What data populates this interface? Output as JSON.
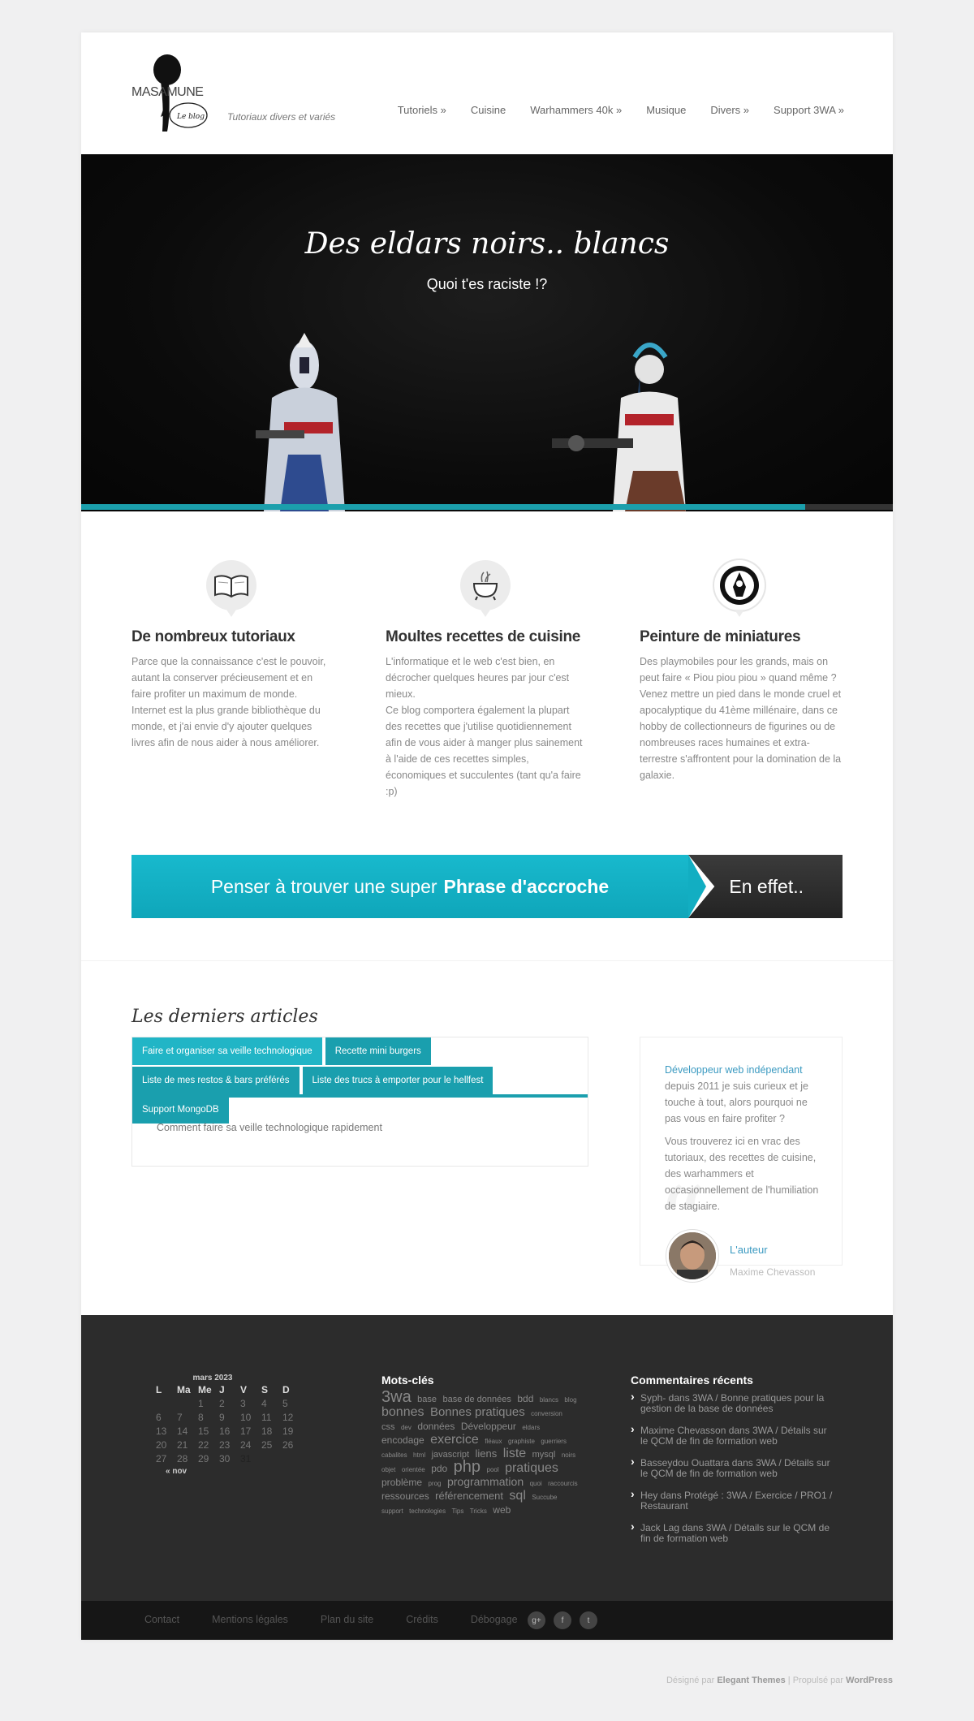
{
  "header": {
    "logo_text": "MASAMUNE",
    "logo_subtext": "Le blog",
    "tagline": "Tutoriaux divers et variés",
    "nav": [
      {
        "label": "Tutoriels »"
      },
      {
        "label": "Cuisine"
      },
      {
        "label": "Warhammers 40k »"
      },
      {
        "label": "Musique"
      },
      {
        "label": "Divers »"
      },
      {
        "label": "Support 3WA »"
      }
    ]
  },
  "hero": {
    "title": "Des eldars noirs.. blancs",
    "subtitle": "Quoi t'es raciste !?",
    "progress_fraction": 0.892
  },
  "features": [
    {
      "icon": "book-icon",
      "title": "De nombreux tutoriaux",
      "text": "Parce que la connaissance c'est le pouvoir, autant la conserver précieusement et en faire profiter un maximum de monde. Internet est la plus grande bibliothèque du monde, et j'ai envie d'y ajouter quelques livres afin de nous aider à nous améliorer."
    },
    {
      "icon": "cauldron-icon",
      "title": "Moultes recettes de cuisine",
      "text": "L'informatique et le web c'est bien, en décrocher quelques heures par jour c'est mieux.\nCe blog comportera également la plupart des recettes que j'utilise quotidiennement afin de vous aider à manger plus sainement à l'aide de ces recettes simples, économiques et succulentes (tant qu'a faire :p)"
    },
    {
      "icon": "eldar-rune-icon",
      "title": "Peinture de miniatures",
      "text": "Des playmobiles pour les grands, mais on peut faire « Piou piou piou » quand même ? Venez mettre un pied dans le monde cruel et apocalyptique du 41ème millénaire, dans ce hobby de collectionneurs de figurines ou de nombreuses races humaines et extra-terrestre s'affrontent pour la domination de la galaxie."
    }
  ],
  "cta": {
    "text_plain": "Penser à trouver une super",
    "text_bold": "Phrase d'accroche",
    "button": "En effet.."
  },
  "articles": {
    "title": "Les derniers articles",
    "tabs": [
      {
        "label": "Faire et organiser sa veille technologique"
      },
      {
        "label": "Recette mini burgers"
      },
      {
        "label": "Liste de mes restos & bars préférés"
      },
      {
        "label": "Liste des trucs à emporter pour le hellfest"
      },
      {
        "label": "Support MongoDB"
      }
    ],
    "active_content": "Comment faire sa veille technologique rapidement"
  },
  "author": {
    "lead": "Développeur web indépendant",
    "para1_rest": "depuis 2011 je suis curieux et je touche à tout, alors pourquoi ne pas vous en faire profiter ?",
    "para2": "Vous trouverez ici en vrac des tutoriaux, des recettes de cuisine, des warhammers et occasionnellement de l'humiliation de stagiaire.",
    "label": "L'auteur",
    "name": "Maxime Chevasson"
  },
  "calendar": {
    "caption": "mars 2023",
    "headers": [
      "L",
      "Ma",
      "Me",
      "J",
      "V",
      "S",
      "D"
    ],
    "rows": [
      [
        "",
        "",
        "",
        "1",
        "2",
        "3",
        "4",
        "5"
      ],
      [
        "6",
        "7",
        "8",
        "9",
        "10",
        "11",
        "12"
      ],
      [
        "13",
        "14",
        "15",
        "16",
        "17",
        "18",
        "19"
      ],
      [
        "20",
        "21",
        "22",
        "23",
        "24",
        "25",
        "26"
      ],
      [
        "27",
        "28",
        "29",
        "30",
        "31",
        "",
        ""
      ]
    ],
    "prev": "« nov"
  },
  "tags": {
    "title": "Mots-clés",
    "items": [
      {
        "t": "3wa",
        "s": 20
      },
      {
        "t": "base",
        "s": 11
      },
      {
        "t": "base de données",
        "s": 11
      },
      {
        "t": "bdd",
        "s": 12
      },
      {
        "t": "blancs",
        "s": 8
      },
      {
        "t": "blog",
        "s": 8
      },
      {
        "t": "bonnes",
        "s": 16
      },
      {
        "t": "Bonnes pratiques",
        "s": 15
      },
      {
        "t": "conversion",
        "s": 8
      },
      {
        "t": "css",
        "s": 11
      },
      {
        "t": "dev",
        "s": 8
      },
      {
        "t": "données",
        "s": 12
      },
      {
        "t": "Développeur",
        "s": 12
      },
      {
        "t": "eldars",
        "s": 8
      },
      {
        "t": "encodage",
        "s": 12
      },
      {
        "t": "exercice",
        "s": 16
      },
      {
        "t": "fléaux",
        "s": 8
      },
      {
        "t": "graphiste",
        "s": 8
      },
      {
        "t": "guerriers",
        "s": 8
      },
      {
        "t": "cabalites",
        "s": 8
      },
      {
        "t": "html",
        "s": 8
      },
      {
        "t": "javascript",
        "s": 11
      },
      {
        "t": "liens",
        "s": 13
      },
      {
        "t": "liste",
        "s": 16
      },
      {
        "t": "mysql",
        "s": 11
      },
      {
        "t": "noirs",
        "s": 8
      },
      {
        "t": "objet",
        "s": 8
      },
      {
        "t": "orientée",
        "s": 8
      },
      {
        "t": "pdo",
        "s": 12
      },
      {
        "t": "php",
        "s": 20
      },
      {
        "t": "pool",
        "s": 8
      },
      {
        "t": "pratiques",
        "s": 16
      },
      {
        "t": "problème",
        "s": 12
      },
      {
        "t": "prog",
        "s": 8
      },
      {
        "t": "programmation",
        "s": 14
      },
      {
        "t": "quoi",
        "s": 8
      },
      {
        "t": "raccourcis",
        "s": 8
      },
      {
        "t": "ressources",
        "s": 12
      },
      {
        "t": "référencement",
        "s": 13
      },
      {
        "t": "sql",
        "s": 16
      },
      {
        "t": "Succube",
        "s": 8
      },
      {
        "t": "support",
        "s": 8
      },
      {
        "t": "technologies",
        "s": 8
      },
      {
        "t": "Tips",
        "s": 8
      },
      {
        "t": "Tricks",
        "s": 8
      },
      {
        "t": "web",
        "s": 12
      }
    ]
  },
  "comments": {
    "title": "Commentaires récents",
    "items": [
      "Syph- dans 3WA / Bonne pratiques pour la gestion de la base de données",
      "Maxime Chevasson dans 3WA / Détails sur le QCM de fin de formation web",
      "Basseydou Ouattara dans 3WA / Détails sur le QCM de fin de formation web",
      "Hey dans Protégé : 3WA / Exercice / PRO1 / Restaurant",
      "Jack Lag dans 3WA / Détails sur le QCM de fin de formation web"
    ]
  },
  "bottom": {
    "links": [
      "Contact",
      "Mentions légales",
      "Plan du site",
      "Crédits",
      "Débogage"
    ],
    "social": [
      "g+",
      "f",
      "t"
    ]
  },
  "credits": {
    "designed_by": "Désigné par",
    "designer": "Elegant Themes",
    "separator": "|",
    "powered_by": "Propulsé par",
    "platform": "WordPress"
  },
  "colors": {
    "accent": "#1a9fae",
    "footer": "#2c2c2c",
    "link": "#3b9ac1"
  }
}
